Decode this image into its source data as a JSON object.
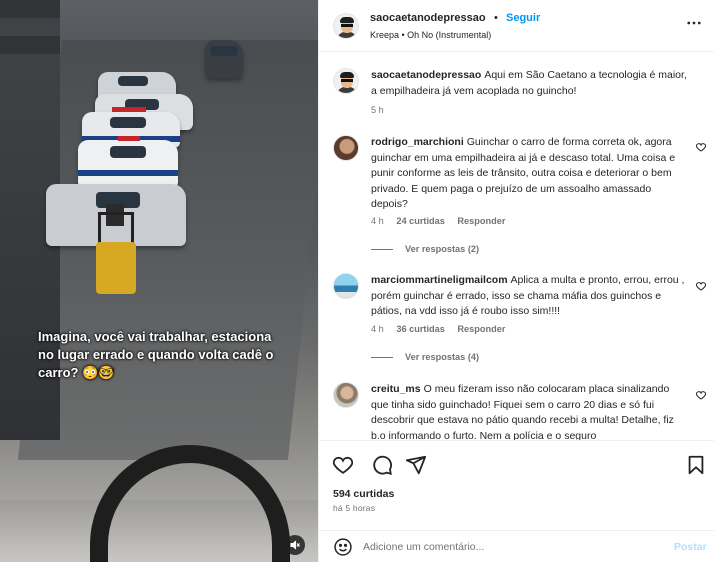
{
  "post": {
    "username": "saocaetanodepressao",
    "separator": "•",
    "follow_label": "Seguir",
    "music": "Kreepa • Oh No (Instrumental)",
    "more_icon": "more-horizontal-icon",
    "video_caption": "Imagina, você vai trabalhar, estaciona no lugar errado e quando volta cadê o carro? 😳🤓"
  },
  "comments": [
    {
      "username": "saocaetanodepressao",
      "text": "Aqui em São Caetano a tecnologia é maior, a empilhadeira já vem acoplada no guincho!",
      "time": "5 h"
    },
    {
      "username": "rodrigo_marchioni",
      "text": "Guinchar o carro de forma correta ok, agora guinchar em uma empilhadeira ai já e descaso total. Uma coisa e punir conforme as leis de trânsito, outra coisa e deteriorar o bem privado. E quem paga o prejuízo de um assoalho amassado depois?",
      "time": "4 h",
      "likes": "24 curtidas",
      "reply_label": "Responder",
      "view_replies": "Ver respostas (2)"
    },
    {
      "username": "marciommartineligmailcom",
      "text": "Aplica a multa e pronto, errou, errou , porém guinchar é errado, isso se chama máfia dos guinchos e pátios, na vdd isso já é roubo isso sim!!!!",
      "time": "4 h",
      "likes": "36 curtidas",
      "reply_label": "Responder",
      "view_replies": "Ver respostas (4)"
    },
    {
      "username": "creitu_ms",
      "text": "O meu fizeram isso não colocaram placa sinalizando que tinha sido guinchado! Fiquei sem o carro 20 dias e só fui descobrir que estava no pátio quando recebi a multa! Detalhe, fiz b.o informando o furto. Nem a polícia e o seguro"
    }
  ],
  "actions": {
    "icons": [
      "heart-icon",
      "comment-icon",
      "share-icon",
      "bookmark-icon"
    ],
    "likes": "594 curtidas",
    "time": "há 5 horas"
  },
  "add_comment": {
    "placeholder": "Adicione um comentário...",
    "post_label": "Postar"
  },
  "colors": {
    "accent": "#0095f6",
    "post_disabled": "#b2dffc",
    "text": "#262626",
    "muted": "#737373"
  }
}
